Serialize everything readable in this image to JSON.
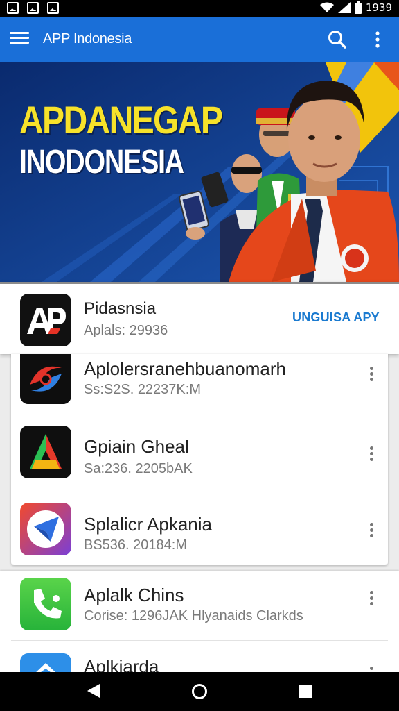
{
  "status_bar": {
    "time": "1939"
  },
  "app_bar": {
    "title": "APP Indonesia",
    "menu_icon": "hamburger-menu-icon",
    "search_icon": "search-icon",
    "more_icon": "more-vert-icon"
  },
  "banner": {
    "title": "APDANEGAP",
    "subtitle": "INODONESIA",
    "colors": {
      "title": "#f7e22a",
      "background": "#14489e",
      "jacket": "#e5471b"
    }
  },
  "featured": {
    "icon_text": "AP",
    "name": "Pidasnsia",
    "meta": "Aplals: 29936",
    "action": "UNGUISA APY"
  },
  "apps": [
    {
      "name": "Aplolersranehbuanomarh",
      "meta": "Ss:S2S. 22237K:M"
    },
    {
      "name": "Gpiain Gheal",
      "meta": "Sa:236. 2205bAK"
    },
    {
      "name": "Splalicr Apkania",
      "meta": "BS536. 20184:M"
    },
    {
      "name": "Aplalk Chins",
      "meta": "Corise: 1296JAK Hlyanaids Clarkds"
    },
    {
      "name": "Aplkiarda",
      "meta": ""
    }
  ],
  "nav": {
    "back_icon": "back-icon",
    "home_icon": "home-icon",
    "recents_icon": "recents-icon"
  },
  "accent_color": "#1a6fd8"
}
